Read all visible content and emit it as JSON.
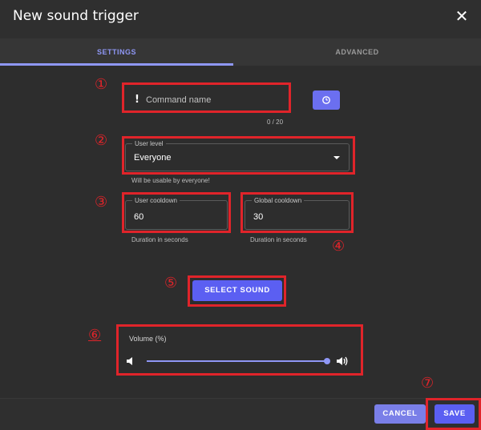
{
  "dialog": {
    "title": "New sound trigger",
    "close_glyph": "✕"
  },
  "tabs": [
    {
      "label": "SETTINGS",
      "active": true
    },
    {
      "label": "ADVANCED",
      "active": false
    }
  ],
  "command": {
    "prefix": "!",
    "placeholder": "Command name",
    "value": "",
    "counter": "0 / 20",
    "icon": "clock-icon"
  },
  "user_level": {
    "label": "User level",
    "value": "Everyone",
    "helper": "Will be usable by everyone!"
  },
  "user_cooldown": {
    "label": "User cooldown",
    "value": "60",
    "helper": "Duration in seconds"
  },
  "global_cooldown": {
    "label": "Global cooldown",
    "value": "30",
    "helper": "Duration in seconds"
  },
  "select_sound_label": "SELECT SOUND",
  "volume": {
    "label": "Volume (%)",
    "value": 100,
    "icon_min": "volume-low-icon",
    "icon_max": "volume-high-icon"
  },
  "footer": {
    "cancel_label": "CANCEL",
    "save_label": "SAVE"
  },
  "annotations": {
    "m1": "①",
    "m2": "②",
    "m3": "③",
    "m4": "④",
    "m5": "⑤",
    "m6": "⑥",
    "m7": "⑦"
  },
  "colors": {
    "accent": "#5b5ff2",
    "highlight": "#e0242a",
    "background": "#2d2d2d"
  }
}
